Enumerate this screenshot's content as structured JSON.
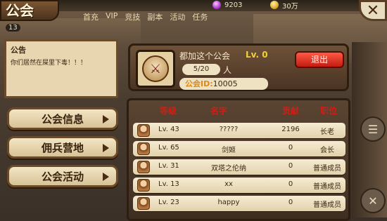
{
  "resources": {
    "gems": "9203",
    "gold": "30万"
  },
  "nav": [
    "首充",
    "VIP",
    "竞技",
    "副本",
    "活动",
    "任务"
  ],
  "player_level": "13",
  "title": "公会",
  "notice": {
    "heading": "公告",
    "text": "你们居然在屎里下毒！！！"
  },
  "menu": [
    "公会信息",
    "佣兵营地",
    "公会活动"
  ],
  "guild": {
    "name": "都加这个公会",
    "level": "Lv. 0",
    "members": "5/20",
    "members_unit": "人",
    "id_label": "公会ID:",
    "id_value": "10005",
    "exit_label": "退出"
  },
  "table": {
    "headers": [
      "等级",
      "名字",
      "贡献",
      "职位"
    ],
    "rows": [
      {
        "level": "Lv. 43",
        "name": "?????",
        "contribution": "2196",
        "position": "长老"
      },
      {
        "level": "Lv. 65",
        "name": "剑姬",
        "contribution": "0",
        "position": "会长"
      },
      {
        "level": "Lv. 31",
        "name": "双塔之伦纳",
        "contribution": "0",
        "position": "普通成员"
      },
      {
        "level": "Lv. 13",
        "name": "xx",
        "contribution": "0",
        "position": "普通成员"
      },
      {
        "level": "Lv. 23",
        "name": "happy",
        "contribution": "0",
        "position": "普通成员"
      }
    ]
  },
  "icons": {
    "close": "close-icon",
    "gem": "gem-icon",
    "gold": "gold-coin-icon",
    "chat": "chat-icon",
    "settings": "crossed-swords-icon"
  }
}
